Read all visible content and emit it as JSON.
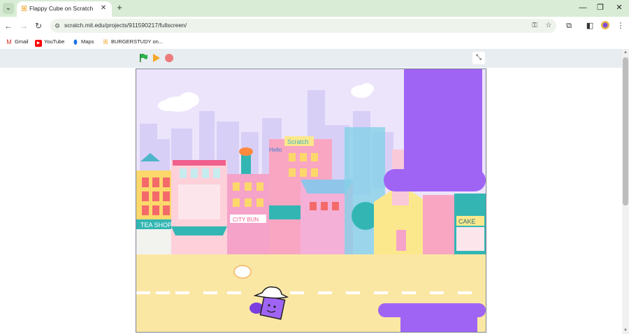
{
  "browser": {
    "tab": {
      "title": "Flappy Cube on Scratch",
      "favicon": "scratch-cat-icon"
    },
    "new_tab": "+",
    "window_controls": {
      "minimize": "—",
      "restore": "❐",
      "close": "✕"
    },
    "omnibox": {
      "url": "scratch.mit.edu/projects/911590217/fullscreen/"
    },
    "bookmarks": [
      {
        "label": "Gmail",
        "icon": "gmail-icon",
        "color": "#d93025"
      },
      {
        "label": "YouTube",
        "icon": "youtube-icon",
        "color": "#ff0000"
      },
      {
        "label": "Maps",
        "icon": "maps-icon",
        "color": "#1a73e8"
      },
      {
        "label": "BURGERSTUDY on...",
        "icon": "burger-icon",
        "color": "#f0a020"
      }
    ]
  },
  "scratch_player": {
    "green_flag_color": "#2fb24c",
    "stop_color": "#ec7b7b",
    "stage": {
      "shop_signs": [
        "TEA SHOP",
        "CITY BUN",
        "CAKE",
        "Scratch",
        "Hello"
      ],
      "obstacle_color": "#a064f5",
      "player": "purple-cube-with-hat"
    }
  },
  "colors": {
    "chrome_bg": "#d9ecd6",
    "scratch_bar_bg": "#e8edf1",
    "road": "#fbe7a4"
  }
}
